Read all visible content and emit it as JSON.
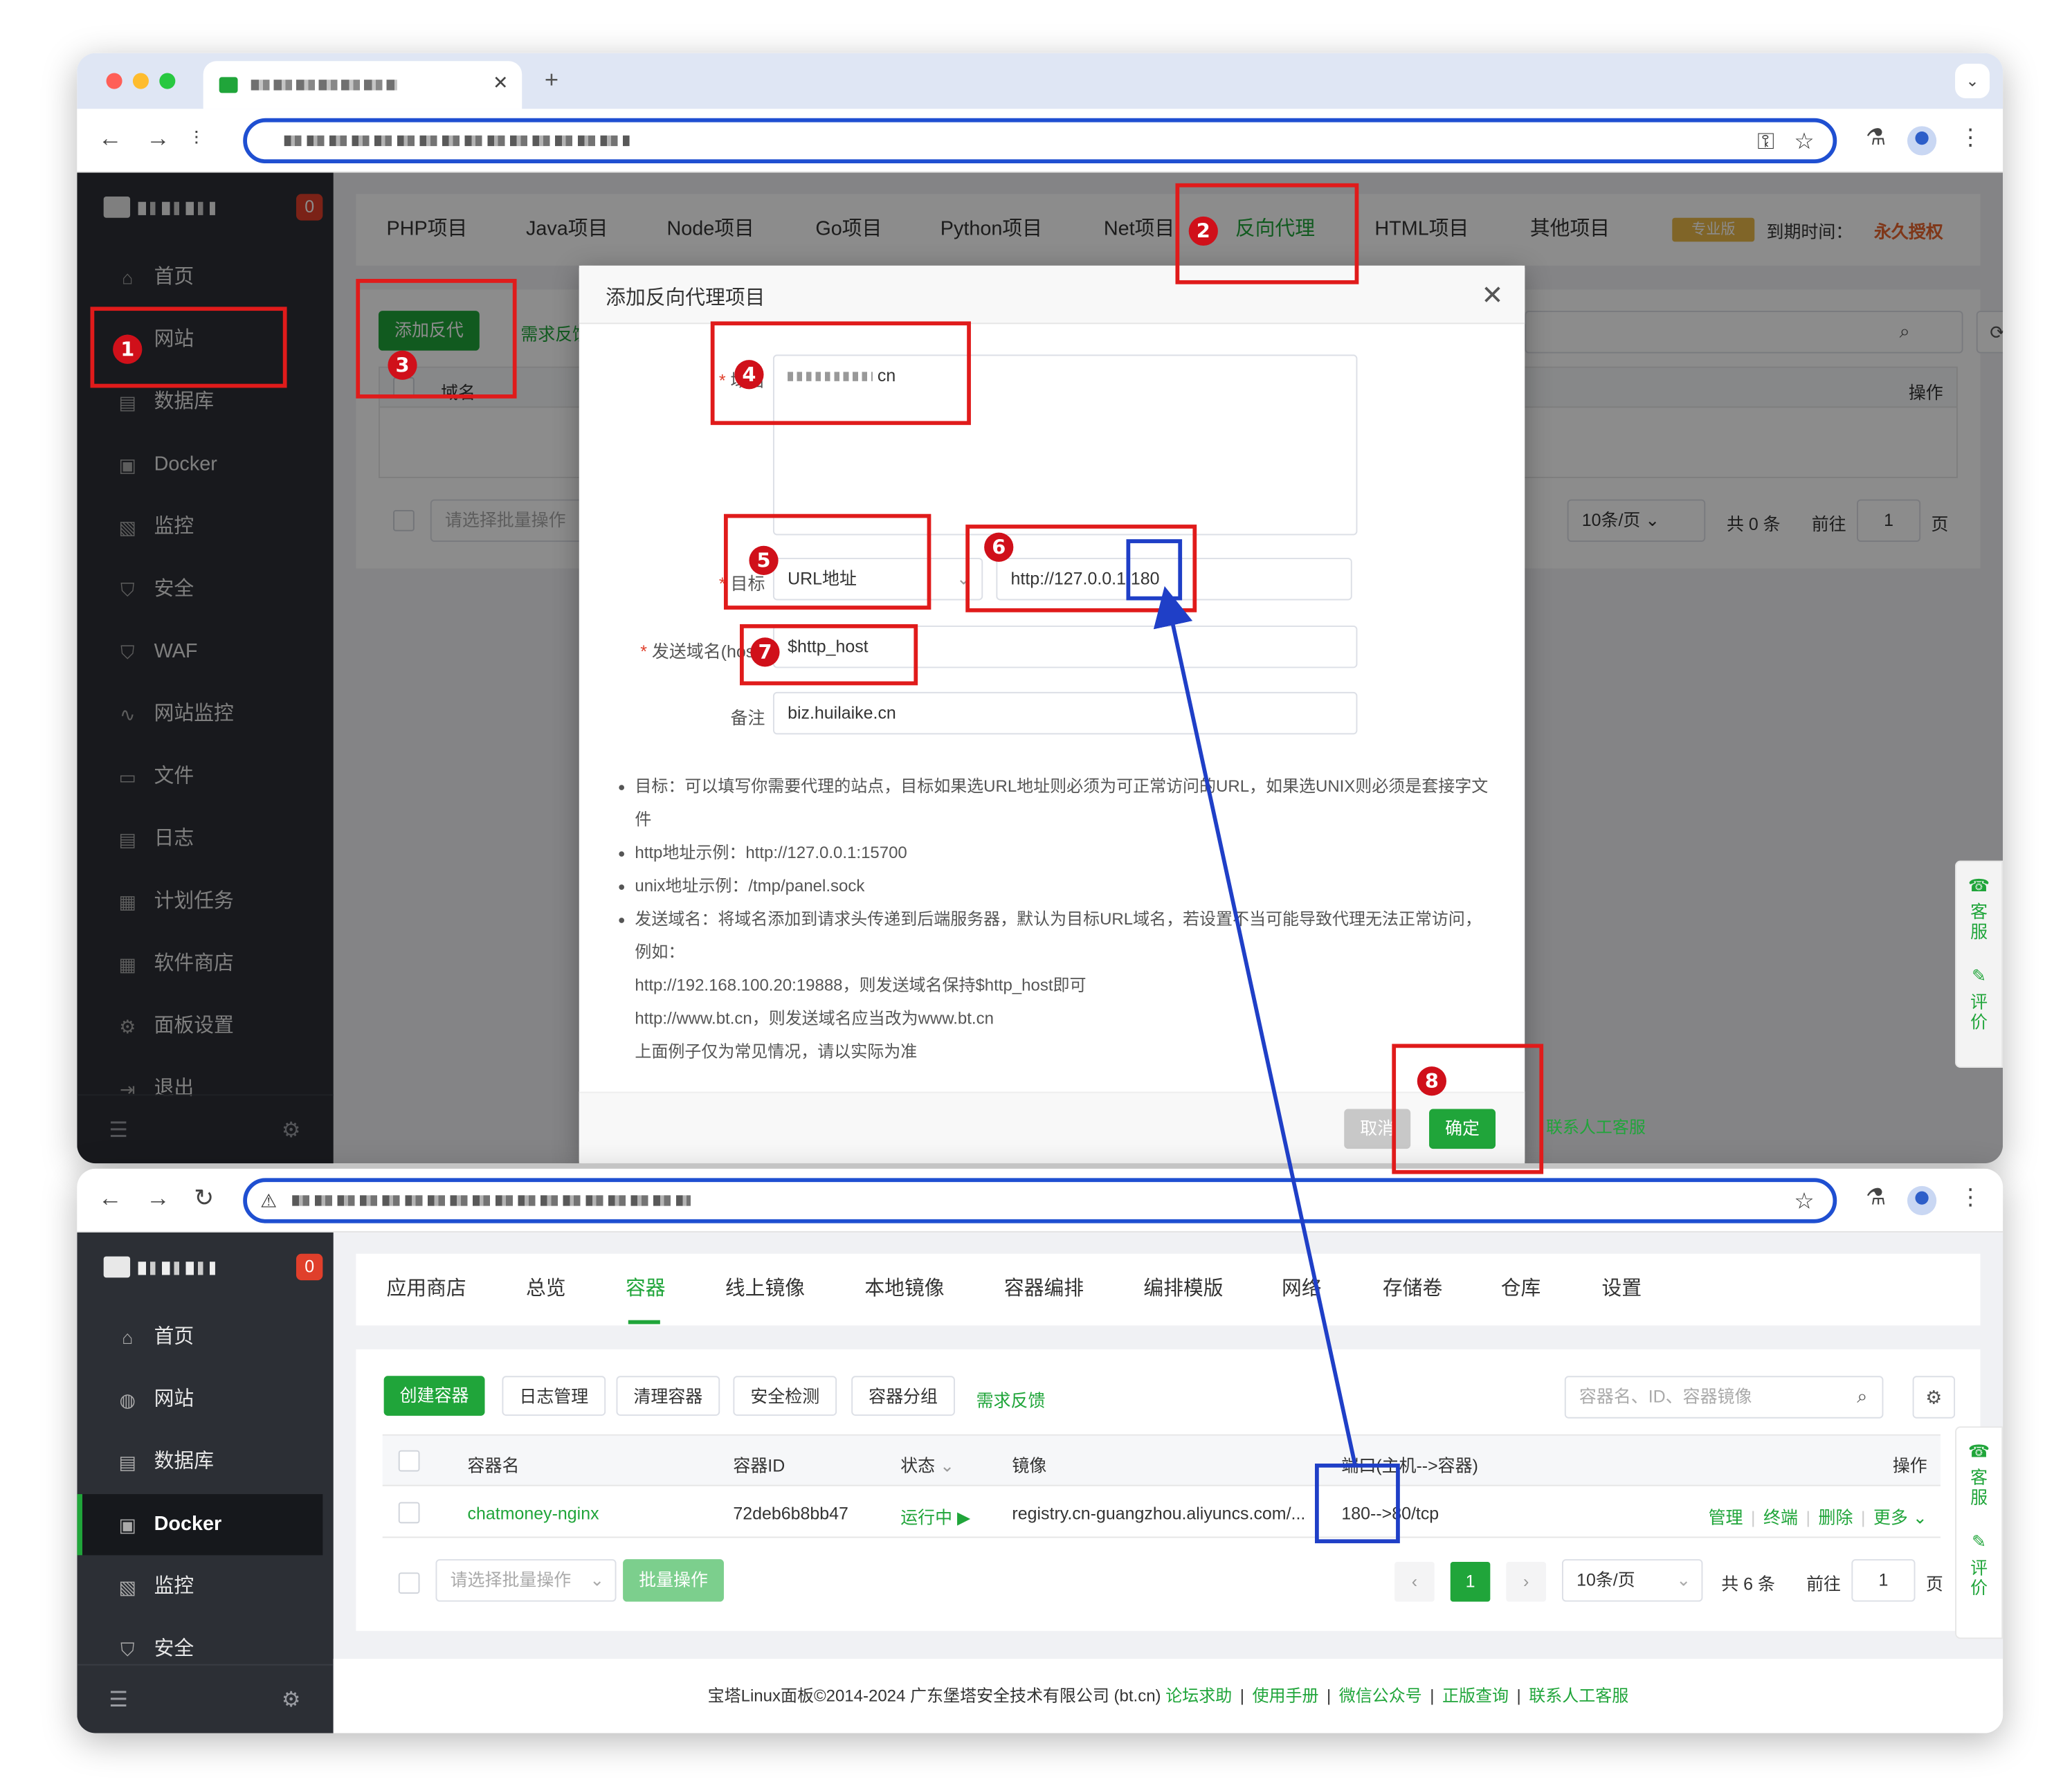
{
  "colors": {
    "accent": "#20a53a",
    "annotation_red": "#e01b1b",
    "annotation_blue": "#1f3fc7",
    "badge_red": "#d0101a",
    "sidebar": "#2c2f35"
  },
  "window1": {
    "sidebar": {
      "badge": "0",
      "items": [
        {
          "label": "首页",
          "icon": "home-icon"
        },
        {
          "label": "网站",
          "icon": "globe-icon"
        },
        {
          "label": "数据库",
          "icon": "database-icon"
        },
        {
          "label": "Docker",
          "icon": "docker-icon"
        },
        {
          "label": "监控",
          "icon": "monitor-icon"
        },
        {
          "label": "安全",
          "icon": "shield-icon"
        },
        {
          "label": "WAF",
          "icon": "waf-shield-icon"
        },
        {
          "label": "网站监控",
          "icon": "chart-icon"
        },
        {
          "label": "文件",
          "icon": "folder-icon"
        },
        {
          "label": "日志",
          "icon": "log-icon"
        },
        {
          "label": "计划任务",
          "icon": "calendar-icon"
        },
        {
          "label": "软件商店",
          "icon": "store-icon"
        },
        {
          "label": "面板设置",
          "icon": "gear-icon"
        },
        {
          "label": "退出",
          "icon": "logout-icon"
        }
      ]
    },
    "project_tabs": [
      "PHP项目",
      "Java项目",
      "Node项目",
      "Go项目",
      "Python项目",
      "Net项目",
      "反向代理",
      "HTML项目",
      "其他项目"
    ],
    "license": {
      "tag": "专业版",
      "label": "到期时间：",
      "value": "永久授权"
    },
    "toolbar": {
      "add_button": "添加反代",
      "feedback": "需求反馈"
    },
    "table_header": {
      "name": "域名",
      "ops": "操作"
    },
    "batch_placeholder": "请选择批量操作",
    "pagination": {
      "per_page": "10条/页",
      "total": "共 0 条",
      "goto": "前往",
      "page": "1",
      "page_unit": "页"
    },
    "contact": "联系人工客服",
    "modal": {
      "title": "添加反向代理项目",
      "domain_label": "域名",
      "domain_value": "cn",
      "target_label": "目标",
      "target_type": "URL地址",
      "target_url": "http://127.0.0.1:180",
      "host_label": "发送域名(host)",
      "host_value": "$http_host",
      "remark_label": "备注",
      "remark_value": "biz.huilaike.cn",
      "notes": [
        {
          "bullet": true,
          "text": "目标：可以填写你需要代理的站点，目标如果选URL地址则必须为可正常访问的URL，如果选UNIX则必须是套接字文"
        },
        {
          "bullet": false,
          "text": "件"
        },
        {
          "bullet": true,
          "text": "http地址示例：http://127.0.0.1:15700"
        },
        {
          "bullet": true,
          "text": "unix地址示例：/tmp/panel.sock"
        },
        {
          "bullet": true,
          "text": "发送域名：将域名添加到请求头传递到后端服务器，默认为目标URL域名，若设置不当可能导致代理无法正常访问，"
        },
        {
          "bullet": false,
          "text": "例如："
        },
        {
          "bullet": false,
          "text": "http://192.168.100.20:19888，则发送域名保持$http_host即可"
        },
        {
          "bullet": false,
          "text": "http://www.bt.cn，则发送域名应当改为www.bt.cn"
        },
        {
          "bullet": false,
          "text": "上面例子仅为常见情况，请以实际为准"
        }
      ],
      "cancel": "取消",
      "confirm": "确定"
    },
    "float": {
      "service": "客服",
      "review": "评价"
    }
  },
  "window2": {
    "sidebar": {
      "badge": "0",
      "items": [
        {
          "label": "首页",
          "icon": "home-icon"
        },
        {
          "label": "网站",
          "icon": "globe-icon"
        },
        {
          "label": "数据库",
          "icon": "database-icon"
        },
        {
          "label": "Docker",
          "icon": "docker-icon"
        },
        {
          "label": "监控",
          "icon": "monitor-icon"
        },
        {
          "label": "安全",
          "icon": "shield-icon"
        }
      ]
    },
    "tabs": [
      "应用商店",
      "总览",
      "容器",
      "线上镜像",
      "本地镜像",
      "容器编排",
      "编排模版",
      "网络",
      "存储卷",
      "仓库",
      "设置"
    ],
    "buttons": [
      "创建容器",
      "日志管理",
      "清理容器",
      "安全检测",
      "容器分组"
    ],
    "feedback": "需求反馈",
    "search_placeholder": "容器名、ID、容器镜像",
    "headers": {
      "name": "容器名",
      "id": "容器ID",
      "status": "状态",
      "image": "镜像",
      "port": "端口(主机-->容器)",
      "ops": "操作"
    },
    "row": {
      "name": "chatmoney-nginx",
      "id": "72deb6b8bb47",
      "status": "运行中",
      "image": "registry.cn-guangzhou.aliyuncs.com/...",
      "port": "180-->80/tcp",
      "ops": [
        "管理",
        "终端",
        "删除",
        "更多"
      ]
    },
    "batch_placeholder": "请选择批量操作",
    "batch_button": "批量操作",
    "pagination": {
      "current": "1",
      "per_page": "10条/页",
      "total": "共 6 条",
      "goto": "前往",
      "page": "1",
      "page_unit": "页"
    },
    "float": {
      "service": "客服",
      "review": "评价"
    },
    "footer": {
      "copyright": "宝塔Linux面板©2014-2024 广东堡塔安全技术有限公司 (bt.cn)",
      "links": [
        "论坛求助",
        "使用手册",
        "微信公众号",
        "正版查询",
        "联系人工客服"
      ]
    }
  },
  "annotations": [
    "1",
    "2",
    "3",
    "4",
    "5",
    "6",
    "7",
    "8"
  ]
}
